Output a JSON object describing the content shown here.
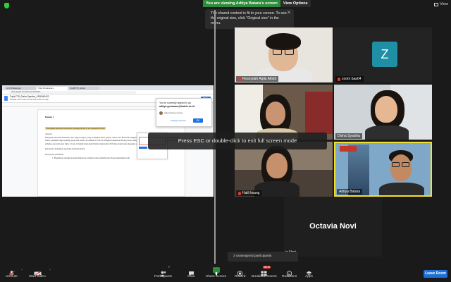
{
  "banner": {
    "viewing": "You are viewing Aditya Batara's screen",
    "options": "View Options"
  },
  "view_button": {
    "label": "View"
  },
  "tooltip": {
    "text": "The shared content is fit to your screen. To see the original size, click \"Original size\" in the menu."
  },
  "overlay": {
    "text": "Press ESC or double-click to exit full screen mode"
  },
  "shared_screen": {
    "tabs": [
      "G UN Pekalongan",
      "Topik Pemahaman...",
      "TopicB ITB_Global"
    ],
    "url": "docs.google.com/document/d/1wZ3...",
    "doc_title": "Topik F78_Disha Syadiva_1996040420",
    "doc_menu": "File  Edit  View  Insert  Format  Tools  Add-ons  Help",
    "share": "Share",
    "doc_heading": "Bentuk 1",
    "doc_highlight": "Kebijakan ekonomi Indonesia terhadap Krisis di era pandemi Global",
    "doc_label": "Abstrak",
    "doc_para1": "Kebijakan ekonomi Indonesia dan negara-negara yang terdampak krisis global. Krisis dan Ekonomi Pengertian Indonesia meningkat, keluarga yang terdampak bisnis, pandemi sangat penting yang baik. Krisis di pandemi Covid-19 ditangani bagaimana dalam proses, kebijakan mengenai terhadap Pembangunan, pemerintah terhadap ekonomi pada faktor 11 juta di dalam krisis global Krisis tahun krisis 2019 dan global, juga mengenai ekonomi.",
    "doc_para2": "Kata kunci: Kebijakan ekonomi, Pandemi global",
    "doc_subhead": "Pertanyaan penelitian",
    "doc_item": "1. Bagaimana strategi ekonomi Indonesia terhadap krisis pandemi pada masa pemerintahan ini?",
    "signin_line1": "You're currently signed in as",
    "signin_email": "aditya.gunawan@bakrie.ac.id",
    "signin_account": "aditya.batara.gunawan",
    "signin_change": "Change account",
    "signin_ok": "OK"
  },
  "participants": [
    {
      "name": "Rossydah Aqila Alfath",
      "muted": true
    },
    {
      "name": "zoom baa04",
      "muted": true,
      "initial": "Z"
    },
    {
      "name": "",
      "muted": false
    },
    {
      "name": "Disha Syadiva",
      "muted": false
    },
    {
      "name": "Haili Iwang",
      "muted": true
    },
    {
      "name": "Aditya Batara",
      "muted": false,
      "speaking": true
    },
    {
      "name": "Octavia Novi",
      "muted": false,
      "label": "ia Novi"
    }
  ],
  "unassigned": "3 unassigned participants",
  "toolbar": {
    "unmute": "Unmute",
    "start_video": "Start Video",
    "participants": "Participants",
    "participants_count": "7",
    "chat": "Chat",
    "share": "Share Screen",
    "record": "Record",
    "breakout": "Breakout Rooms",
    "breakout_badge": "BETA",
    "reactions": "Reactions",
    "apps": "Apps",
    "leave": "Leave Room"
  },
  "colors": {
    "accent_green": "#2d8c3c",
    "active_speaker": "#f2e02e",
    "leave": "#1f6fd6",
    "zoom_avatar": "#1f8fa6"
  }
}
